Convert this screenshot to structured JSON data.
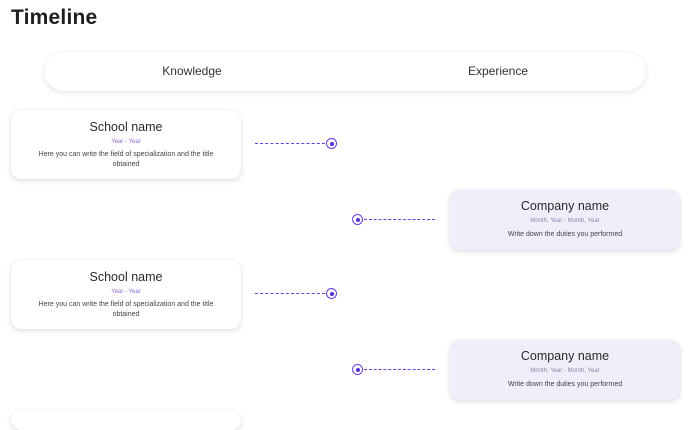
{
  "page": {
    "title": "Timeline"
  },
  "tabs": [
    {
      "label": "Knowledge"
    },
    {
      "label": "Experience"
    }
  ],
  "accent_color": "#6a3fe0",
  "company_card_color": "#f2edfb",
  "entries": [
    {
      "type": "school",
      "title": "School name",
      "dates": "Year - Year",
      "description": "Here you can write the field of specialization and the title obtained"
    },
    {
      "type": "company",
      "title": "Company name",
      "dates": "Month, Year - Month, Year",
      "description": "Write down the duties you performed"
    },
    {
      "type": "school",
      "title": "School name",
      "dates": "Year - Year",
      "description": "Here you can write the field of specialization and the title obtained"
    },
    {
      "type": "company",
      "title": "Company name",
      "dates": "Month, Year - Month, Year",
      "description": "Write down the duties you performed"
    }
  ]
}
